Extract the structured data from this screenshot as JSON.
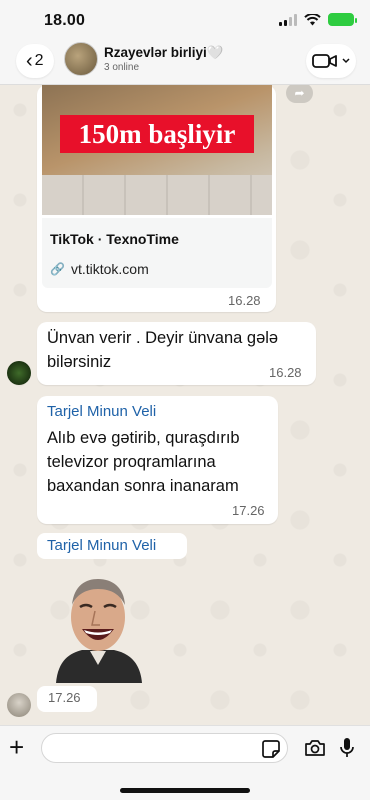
{
  "status_bar": {
    "time": "18.00"
  },
  "header": {
    "back_count": "2",
    "title": "Rzayevlər  birliyi🤍",
    "subtitle": "3 online"
  },
  "messages": {
    "link_preview": {
      "banner_text": "150m başliyir",
      "title": "TikTok · TexnoTime",
      "url": "vt.tiktok.com",
      "time": "16.28"
    },
    "msg2": {
      "text_line1": "Ünvan verir . Deyir ünvana gələ",
      "text_line2": "bilərsiniz",
      "time": "16.28"
    },
    "msg3": {
      "sender": "Tarjel Minun Veli",
      "text_line1": "Alıb evə gətirib, quraşdırıb",
      "text_line2": "televizor proqramlarına",
      "text_line3": "baxandan sonra inanaram",
      "time": "17.26"
    },
    "msg4": {
      "sender": "Tarjel Minun Veli",
      "time": "17.26"
    }
  },
  "input_bar": {
    "placeholder": ""
  },
  "colors": {
    "background": "#efeae2",
    "bubble": "#ffffff",
    "sender_name": "#1f62a8",
    "battery": "#2ecc40",
    "banner": "#e8102a"
  },
  "icons": [
    "chevron-left-icon",
    "video-call-icon",
    "forward-icon",
    "link-icon",
    "plus-icon",
    "sticker-icon",
    "camera-icon",
    "mic-icon"
  ]
}
